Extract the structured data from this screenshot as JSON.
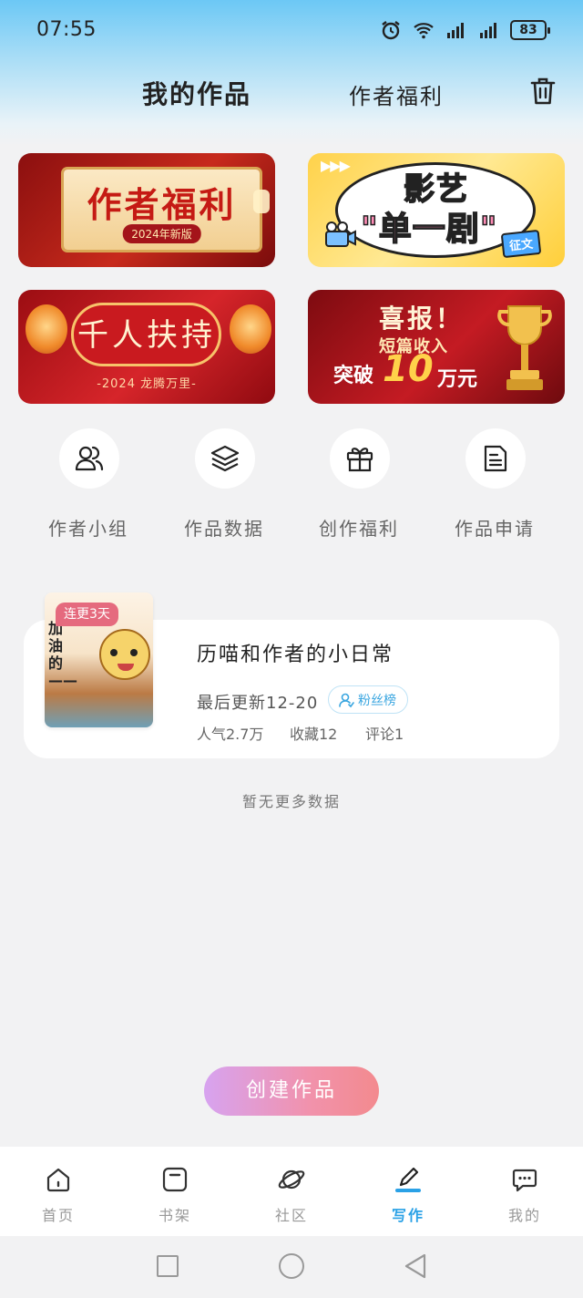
{
  "status_bar": {
    "time": "07:55",
    "battery": "83",
    "icons": [
      "alarm-icon",
      "wifi-icon",
      "signal-icon",
      "signal-icon"
    ]
  },
  "header": {
    "tabs": [
      {
        "label": "我的作品",
        "active": true
      },
      {
        "label": "作者福利",
        "active": false
      }
    ],
    "trash_icon": "trash-icon"
  },
  "banners": [
    {
      "title": "作者福利",
      "tag": "2024年新版"
    },
    {
      "title_1": "影艺",
      "title_2": "\"单一剧\"",
      "tag": "征文"
    },
    {
      "title": "千人扶持",
      "subtitle": "-2024 龙腾万里-"
    },
    {
      "title": "喜报！",
      "line_2": "短篇收入",
      "line_3_prefix": "突破",
      "line_3_number": "10",
      "line_3_suffix": "万元"
    }
  ],
  "quick_menu": [
    {
      "label": "作者小组",
      "icon": "users-icon"
    },
    {
      "label": "作品数据",
      "icon": "layers-icon"
    },
    {
      "label": "创作福利",
      "icon": "gift-icon"
    },
    {
      "label": "作品申请",
      "icon": "document-icon"
    }
  ],
  "work": {
    "badge": "连更3天",
    "cover_text": "加油的——",
    "title": "历喵和作者的小日常",
    "last_update": "最后更新12-20",
    "fans_button": "粉丝榜",
    "popularity": "人气2.7万",
    "favorites": "收藏12",
    "comments": "评论1"
  },
  "no_more_text": "暂无更多数据",
  "create_button": "创建作品",
  "bottom_nav": [
    {
      "label": "首页",
      "icon": "home-icon",
      "active": false
    },
    {
      "label": "书架",
      "icon": "bookshelf-icon",
      "active": false
    },
    {
      "label": "社区",
      "icon": "planet-icon",
      "active": false
    },
    {
      "label": "写作",
      "icon": "pen-icon",
      "active": true
    },
    {
      "label": "我的",
      "icon": "chat-icon",
      "active": false
    }
  ],
  "colors": {
    "accent": "#2aa1e6",
    "badge": "#e56a7e",
    "create_button_start": "#d7a3f0",
    "create_button_end": "#f38a8e"
  }
}
